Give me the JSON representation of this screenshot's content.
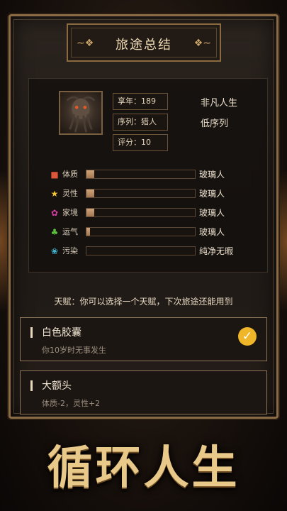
{
  "title": "旅途总结",
  "profile": {
    "age_label": "享年：189",
    "sequence_label": "序列：猎人",
    "score_label": "评分：10",
    "life_rank": "非凡人生",
    "sequence_rank": "低序列"
  },
  "attributes": [
    {
      "label": "体质",
      "icon": "muscle-icon",
      "color": "#e0563a",
      "value": 0.07,
      "rating": "玻璃人"
    },
    {
      "label": "灵性",
      "icon": "star-icon",
      "color": "#f5c531",
      "value": 0.07,
      "rating": "玻璃人"
    },
    {
      "label": "家境",
      "icon": "brain-icon",
      "color": "#d63fa3",
      "value": 0.07,
      "rating": "玻璃人"
    },
    {
      "label": "运气",
      "icon": "clover-icon",
      "color": "#5cc23a",
      "value": 0.03,
      "rating": "玻璃人"
    },
    {
      "label": "污染",
      "icon": "tentacle-icon",
      "color": "#3fb6d1",
      "value": 0.0,
      "rating": "纯净无暇"
    }
  ],
  "talent_hint": "天赋：你可以选择一个天赋，下次旅途还能用到",
  "talents": [
    {
      "name": "白色胶囊",
      "desc": "你10岁时无事发生",
      "selected": true
    },
    {
      "name": "大额头",
      "desc": "体质-2，灵性+2",
      "selected": false
    }
  ],
  "logo_text": "循环人生"
}
